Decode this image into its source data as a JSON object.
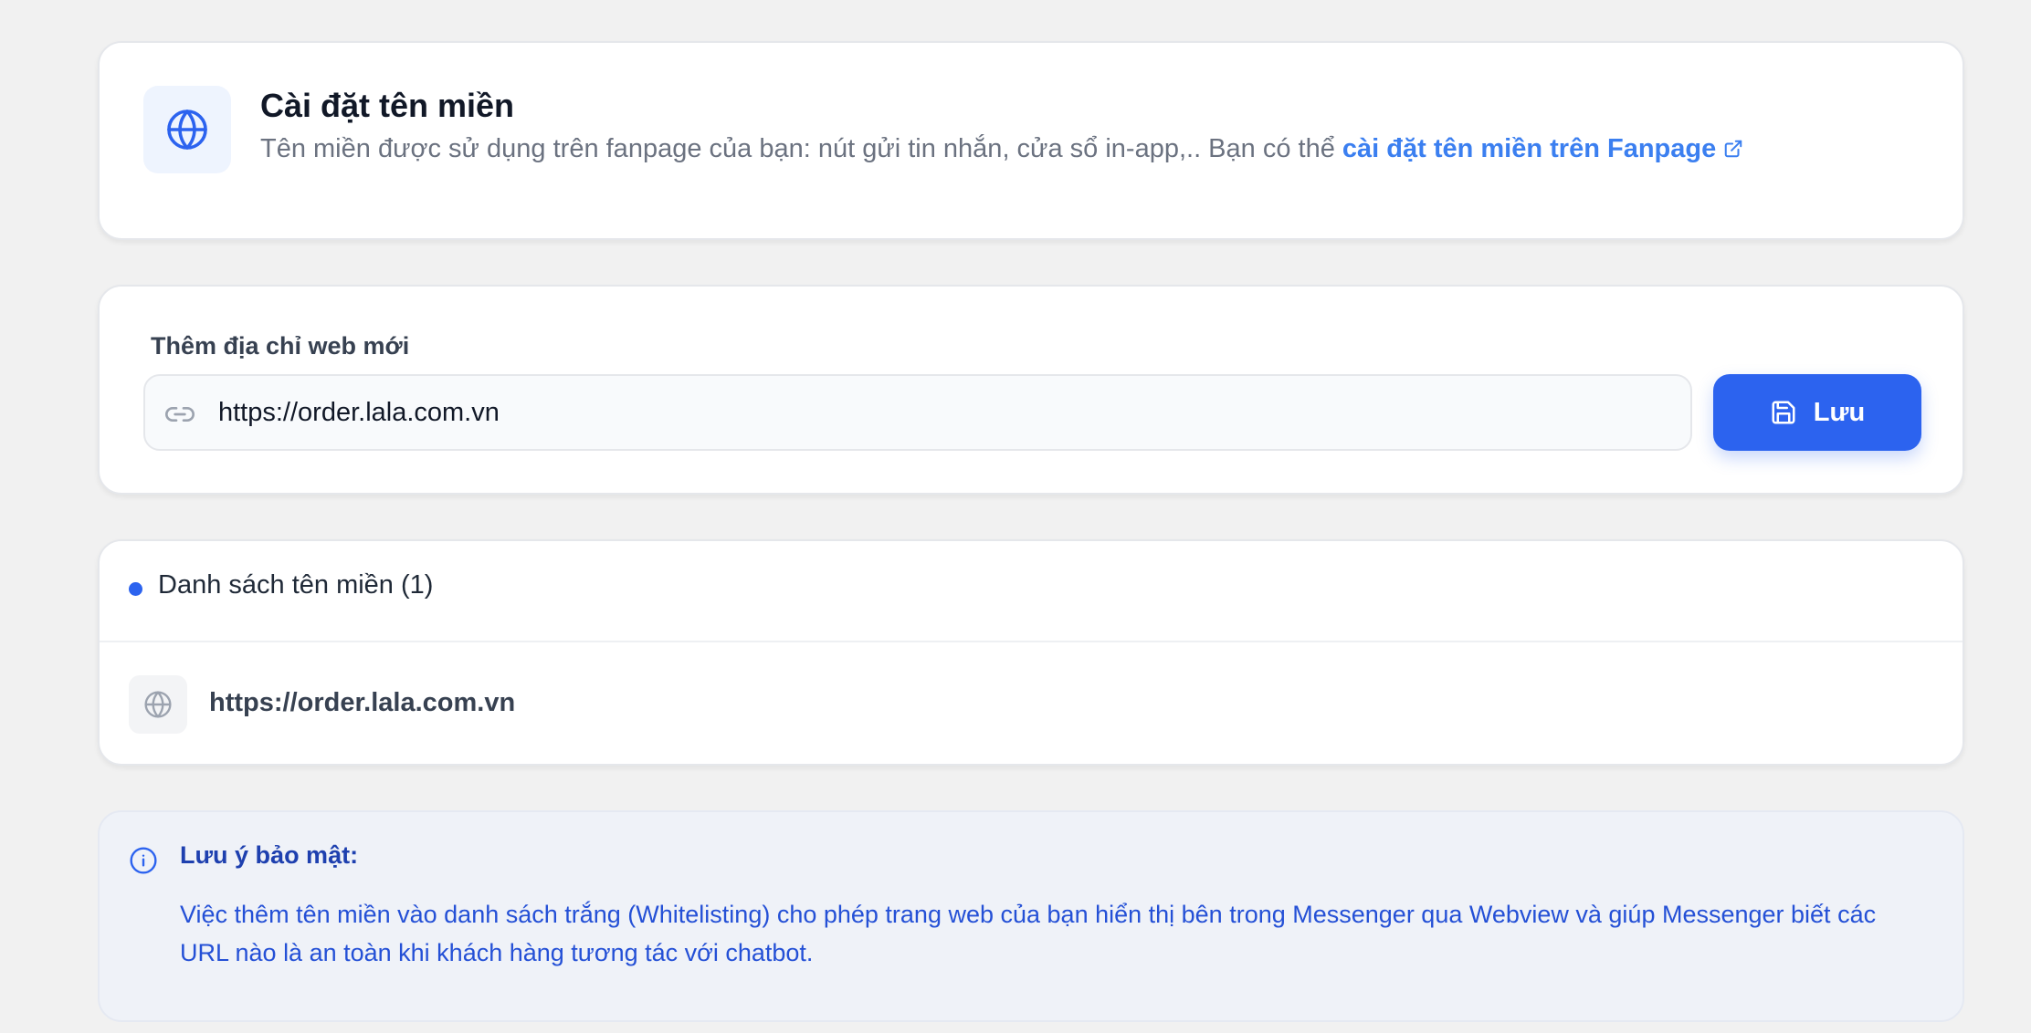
{
  "header": {
    "title": "Cài đặt tên miền",
    "description": "Tên miền được sử dụng trên fanpage của bạn: nút gửi tin nhắn, cửa sổ in-app,.. Bạn có thể",
    "link_text": "cài đặt tên miền trên Fanpage",
    "icon": "globe-icon",
    "link_icon": "external-link-icon"
  },
  "add_domain": {
    "label": "Thêm địa chỉ web mới",
    "input_value": "https://order.lala.com.vn",
    "input_icon": "link-icon",
    "save_label": "Lưu",
    "save_icon": "save-icon"
  },
  "domain_list": {
    "title": "Danh sách tên miền (1)",
    "items": [
      {
        "url": "https://order.lala.com.vn",
        "icon": "globe-icon"
      }
    ]
  },
  "security_note": {
    "title": "Lưu ý bảo mật:",
    "body": "Việc thêm tên miền vào danh sách trắng (Whitelisting) cho phép trang web của bạn hiển thị bên trong Messenger qua Webview và giúp Messenger biết các URL nào là an toàn khi khách hàng tương tác với chatbot.",
    "icon": "info-icon"
  },
  "colors": {
    "accent": "#2c63ef",
    "link": "#3b7ff0",
    "background": "#f1f1f1",
    "note_background": "#eff2f8",
    "note_text": "#2450d6"
  }
}
